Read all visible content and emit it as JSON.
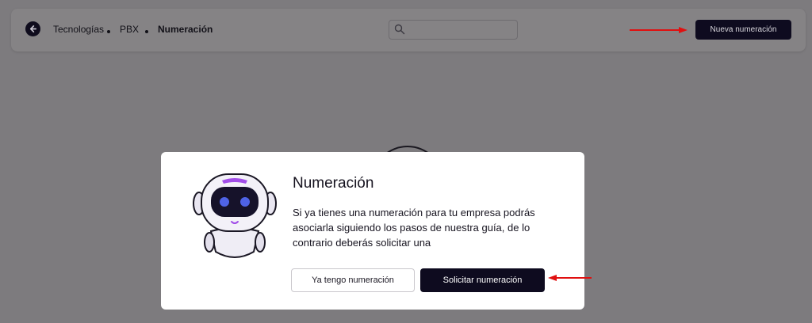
{
  "header": {
    "back_icon": "arrow-left-icon",
    "breadcrumb": [
      "Tecnologías",
      "PBX",
      "Numeración"
    ],
    "search": {
      "icon": "search-icon",
      "placeholder": "",
      "value": ""
    },
    "new_button_label": "Nueva numeración"
  },
  "modal": {
    "illustration": "robot-icon",
    "title": "Numeración",
    "text": "Si ya tienes una numeración para tu empresa podrás asociarla siguiendo los pasos de nuestra guía, de lo contrario deberás solicitar una",
    "secondary_button_label": "Ya tengo numeración",
    "primary_button_label": "Solicitar numeración"
  },
  "colors": {
    "overlay": "#7d7b7e",
    "primary_dark": "#0e0b1f",
    "annotation_arrow": "#e01010",
    "robot_accent": "#a24ee8",
    "robot_eyes": "#4f63e6"
  }
}
